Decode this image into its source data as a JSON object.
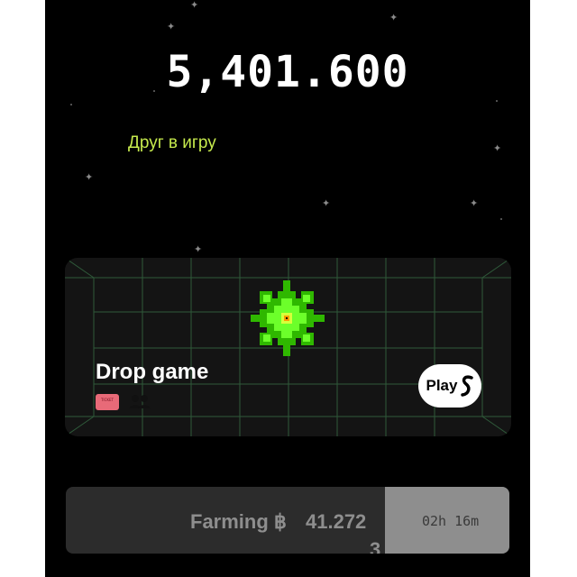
{
  "balance": "5,401.600",
  "friend_link": "Друг в игру",
  "game_card": {
    "title": "Drop game",
    "ticket_text": "TICKET",
    "play_label": "Play",
    "accent_color": "#39ff14"
  },
  "farming": {
    "label": "Farming ฿",
    "value_main": "41.272",
    "value_tail": "3",
    "timer": "02h 16m",
    "progress": 0.72
  }
}
